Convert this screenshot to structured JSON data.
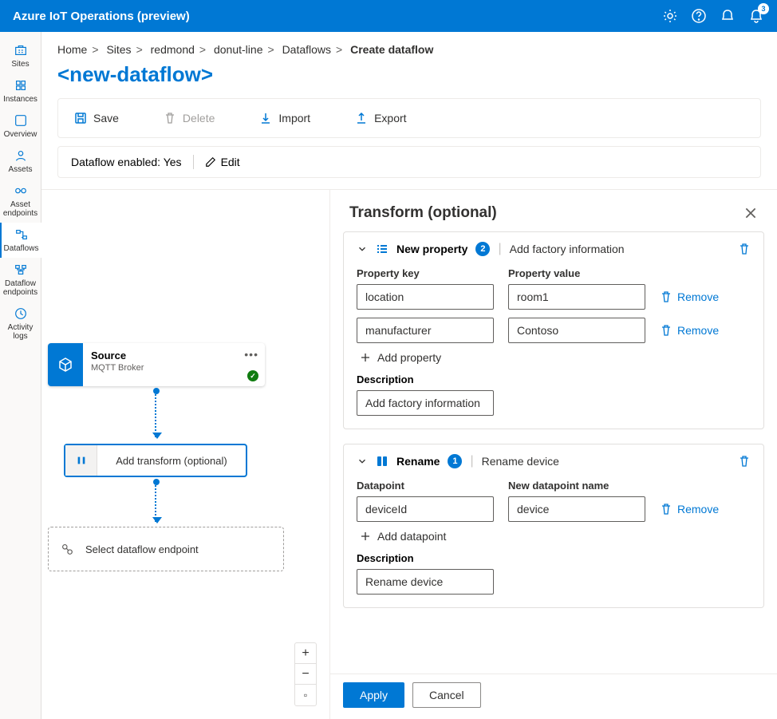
{
  "app_title": "Azure IoT Operations (preview)",
  "notification_count": "3",
  "leftnav": [
    {
      "id": "sites",
      "label": "Sites"
    },
    {
      "id": "instances",
      "label": "Instances"
    },
    {
      "id": "overview",
      "label": "Overview"
    },
    {
      "id": "assets",
      "label": "Assets"
    },
    {
      "id": "asset-endpoints",
      "label": "Asset endpoints"
    },
    {
      "id": "dataflows",
      "label": "Dataflows"
    },
    {
      "id": "dataflow-endpoints",
      "label": "Dataflow endpoints"
    },
    {
      "id": "activity-logs",
      "label": "Activity logs"
    }
  ],
  "breadcrumbs": {
    "home": "Home",
    "sites": "Sites",
    "site_name": "redmond",
    "instance_name": "donut-line",
    "section": "Dataflows",
    "current": "Create dataflow"
  },
  "page_title": "<new-dataflow>",
  "toolbar": {
    "save": "Save",
    "delete": "Delete",
    "import": "Import",
    "export": "Export"
  },
  "status": {
    "label": "Dataflow enabled:",
    "value": "Yes",
    "edit": "Edit"
  },
  "canvas": {
    "source": {
      "title": "Source",
      "subtitle": "MQTT Broker"
    },
    "transform": {
      "label": "Add transform (optional)"
    },
    "dest": {
      "label": "Select dataflow endpoint"
    }
  },
  "panel": {
    "title": "Transform (optional)",
    "apply": "Apply",
    "cancel": "Cancel",
    "card_newprop": {
      "name": "New property",
      "count": "2",
      "summary": "Add factory information",
      "key_label": "Property key",
      "val_label": "Property value",
      "rows": [
        {
          "key": "location",
          "value": "room1"
        },
        {
          "key": "manufacturer",
          "value": "Contoso"
        }
      ],
      "add_label": "Add property",
      "remove_label": "Remove",
      "desc_label": "Description",
      "desc_value": "Add factory information"
    },
    "card_rename": {
      "name": "Rename",
      "count": "1",
      "summary": "Rename device",
      "dp_label": "Datapoint",
      "new_label": "New datapoint name",
      "rows": [
        {
          "old": "deviceId",
          "new": "device"
        }
      ],
      "add_label": "Add datapoint",
      "remove_label": "Remove",
      "desc_label": "Description",
      "desc_value": "Rename device"
    }
  }
}
